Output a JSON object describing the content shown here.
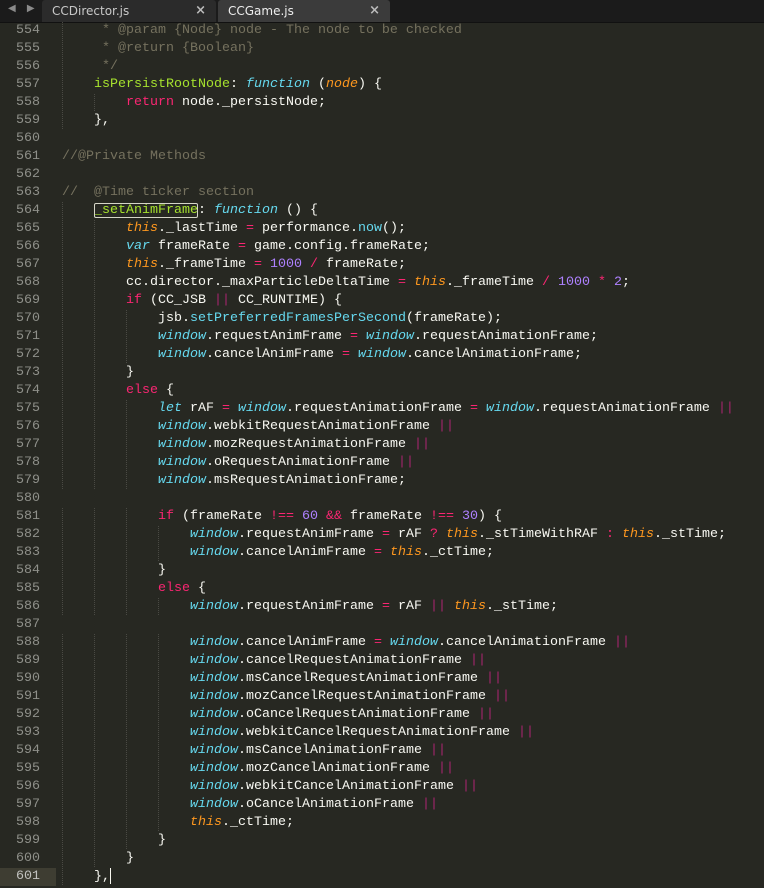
{
  "tabs": [
    {
      "label": "CCDirector.js",
      "active": false,
      "close": "×"
    },
    {
      "label": "CCGame.js",
      "active": true,
      "close": "×"
    }
  ],
  "nav_arrows": "◀ ▶",
  "colors": {
    "background": "#272822",
    "keyword": "#f92672",
    "storage": "#66d9ef",
    "this": "#fd971f",
    "number": "#ae81ff",
    "entity": "#a6e22e",
    "comment": "#75715e"
  },
  "word_highlight": {
    "line": "564",
    "word": "_setAnimFrame"
  },
  "cursor_line": "601",
  "lines": [
    {
      "n": "554",
      "text": "     * @param {Node} node - The node to be checked"
    },
    {
      "n": "555",
      "text": "     * @return {Boolean}"
    },
    {
      "n": "556",
      "text": "     */"
    },
    {
      "n": "557",
      "text": "    isPersistRootNode: function (node) {"
    },
    {
      "n": "558",
      "text": "        return node._persistNode;"
    },
    {
      "n": "559",
      "text": "    },"
    },
    {
      "n": "560",
      "text": ""
    },
    {
      "n": "561",
      "text": "//@Private Methods"
    },
    {
      "n": "562",
      "text": ""
    },
    {
      "n": "563",
      "text": "//  @Time ticker section"
    },
    {
      "n": "564",
      "text": "    _setAnimFrame: function () {"
    },
    {
      "n": "565",
      "text": "        this._lastTime = performance.now();"
    },
    {
      "n": "566",
      "text": "        var frameRate = game.config.frameRate;"
    },
    {
      "n": "567",
      "text": "        this._frameTime = 1000 / frameRate;"
    },
    {
      "n": "568",
      "text": "        cc.director._maxParticleDeltaTime = this._frameTime / 1000 * 2;"
    },
    {
      "n": "569",
      "text": "        if (CC_JSB || CC_RUNTIME) {"
    },
    {
      "n": "570",
      "text": "            jsb.setPreferredFramesPerSecond(frameRate);"
    },
    {
      "n": "571",
      "text": "            window.requestAnimFrame = window.requestAnimationFrame;"
    },
    {
      "n": "572",
      "text": "            window.cancelAnimFrame = window.cancelAnimationFrame;"
    },
    {
      "n": "573",
      "text": "        }"
    },
    {
      "n": "574",
      "text": "        else {"
    },
    {
      "n": "575",
      "text": "            let rAF = window.requestAnimationFrame = window.requestAnimationFrame ||"
    },
    {
      "n": "576",
      "text": "            window.webkitRequestAnimationFrame ||"
    },
    {
      "n": "577",
      "text": "            window.mozRequestAnimationFrame ||"
    },
    {
      "n": "578",
      "text": "            window.oRequestAnimationFrame ||"
    },
    {
      "n": "579",
      "text": "            window.msRequestAnimationFrame;"
    },
    {
      "n": "580",
      "text": ""
    },
    {
      "n": "581",
      "text": "            if (frameRate !== 60 && frameRate !== 30) {"
    },
    {
      "n": "582",
      "text": "                window.requestAnimFrame = rAF ? this._stTimeWithRAF : this._stTime;"
    },
    {
      "n": "583",
      "text": "                window.cancelAnimFrame = this._ctTime;"
    },
    {
      "n": "584",
      "text": "            }"
    },
    {
      "n": "585",
      "text": "            else {"
    },
    {
      "n": "586",
      "text": "                window.requestAnimFrame = rAF || this._stTime;"
    },
    {
      "n": "587",
      "text": ""
    },
    {
      "n": "588",
      "text": "                window.cancelAnimFrame = window.cancelAnimationFrame ||"
    },
    {
      "n": "589",
      "text": "                window.cancelRequestAnimationFrame ||"
    },
    {
      "n": "590",
      "text": "                window.msCancelRequestAnimationFrame ||"
    },
    {
      "n": "591",
      "text": "                window.mozCancelRequestAnimationFrame ||"
    },
    {
      "n": "592",
      "text": "                window.oCancelRequestAnimationFrame ||"
    },
    {
      "n": "593",
      "text": "                window.webkitCancelRequestAnimationFrame ||"
    },
    {
      "n": "594",
      "text": "                window.msCancelAnimationFrame ||"
    },
    {
      "n": "595",
      "text": "                window.mozCancelAnimationFrame ||"
    },
    {
      "n": "596",
      "text": "                window.webkitCancelAnimationFrame ||"
    },
    {
      "n": "597",
      "text": "                window.oCancelAnimationFrame ||"
    },
    {
      "n": "598",
      "text": "                this._ctTime;"
    },
    {
      "n": "599",
      "text": "            }"
    },
    {
      "n": "600",
      "text": "        }"
    },
    {
      "n": "601",
      "text": "    },"
    }
  ]
}
